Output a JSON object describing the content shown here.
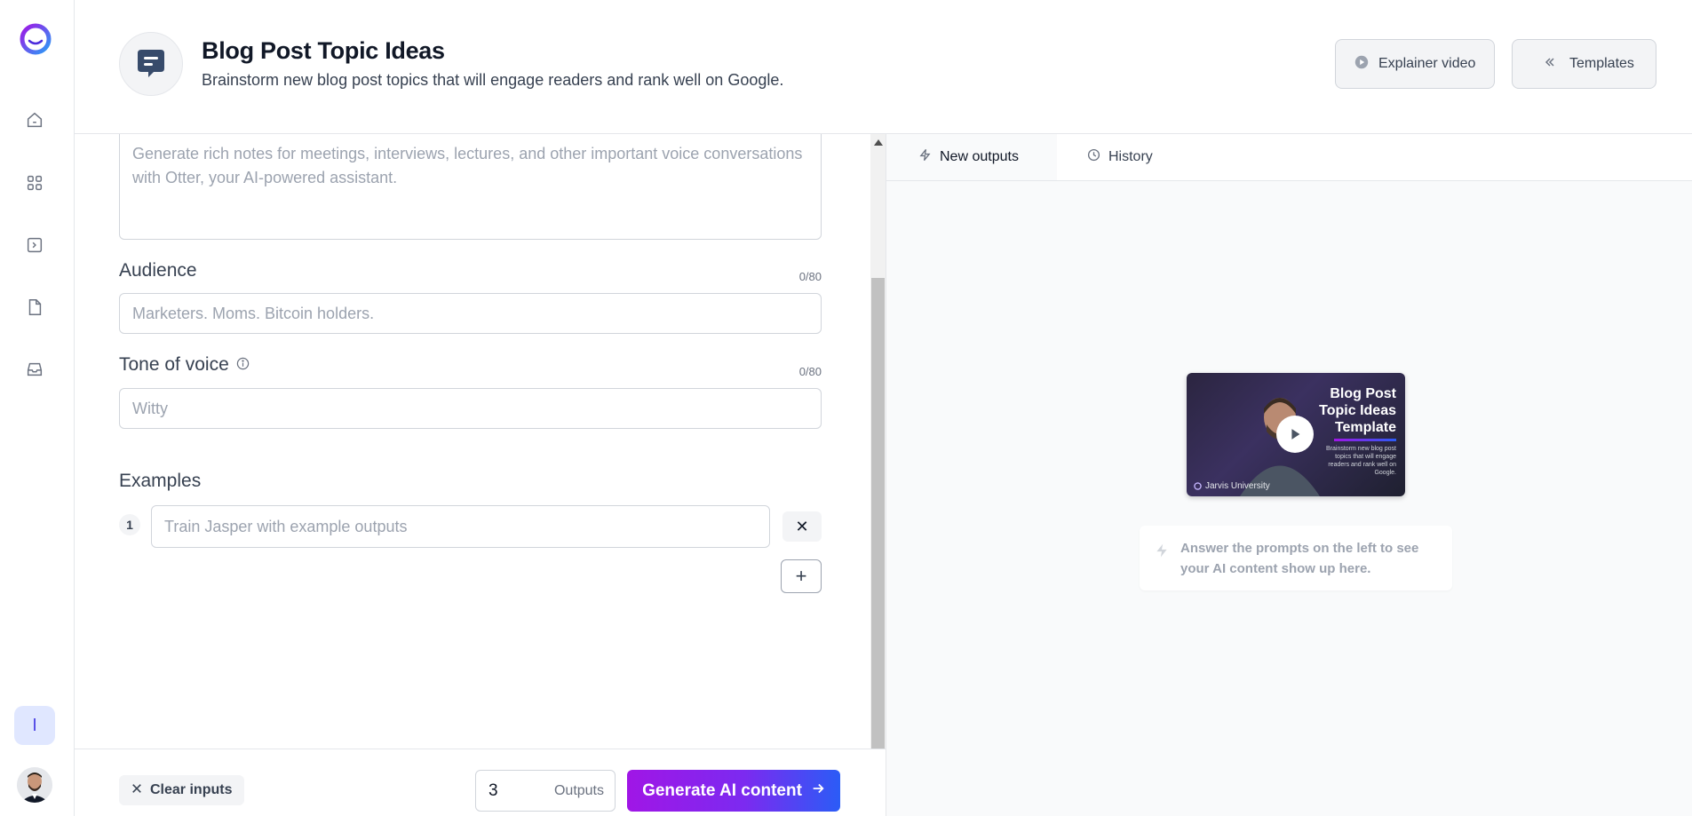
{
  "header": {
    "title": "Blog Post Topic Ideas",
    "subtitle": "Brainstorm new blog post topics that will engage readers and rank well on Google.",
    "explainer_label": "Explainer video",
    "templates_label": "Templates"
  },
  "rail": {
    "initial": "I"
  },
  "form": {
    "description_placeholder": "Generate rich notes for meetings, interviews, lectures, and other important voice conversations with Otter, your AI-powered assistant.",
    "audience": {
      "label": "Audience",
      "counter": "0/80",
      "placeholder": "Marketers. Moms. Bitcoin holders."
    },
    "tone": {
      "label": "Tone of voice",
      "counter": "0/80",
      "placeholder": "Witty"
    },
    "examples": {
      "label": "Examples",
      "items": [
        {
          "number": "1",
          "placeholder": "Train Jasper with example outputs"
        }
      ],
      "add_label": "+",
      "remove_label": "✕"
    }
  },
  "footer": {
    "clear_label": "Clear inputs",
    "outputs_value": "3",
    "outputs_label": "Outputs",
    "generate_label": "Generate AI content"
  },
  "output": {
    "tabs": [
      {
        "label": "New outputs",
        "icon": "lightning-icon",
        "active": true
      },
      {
        "label": "History",
        "icon": "clock-icon",
        "active": false
      }
    ],
    "video": {
      "title_line1": "Blog Post",
      "title_line2": "Topic Ideas",
      "title_line3": "Template",
      "description": "Brainstorm new blog post topics that will engage readers and rank well on Google.",
      "brand": "Jarvis University"
    },
    "hint": "Answer the prompts on the left to see your AI content show up here."
  },
  "colors": {
    "accent_start": "#a016e6",
    "accent_end": "#2b5cf6",
    "border": "#d1d5db",
    "muted_text": "#9ca3af"
  }
}
